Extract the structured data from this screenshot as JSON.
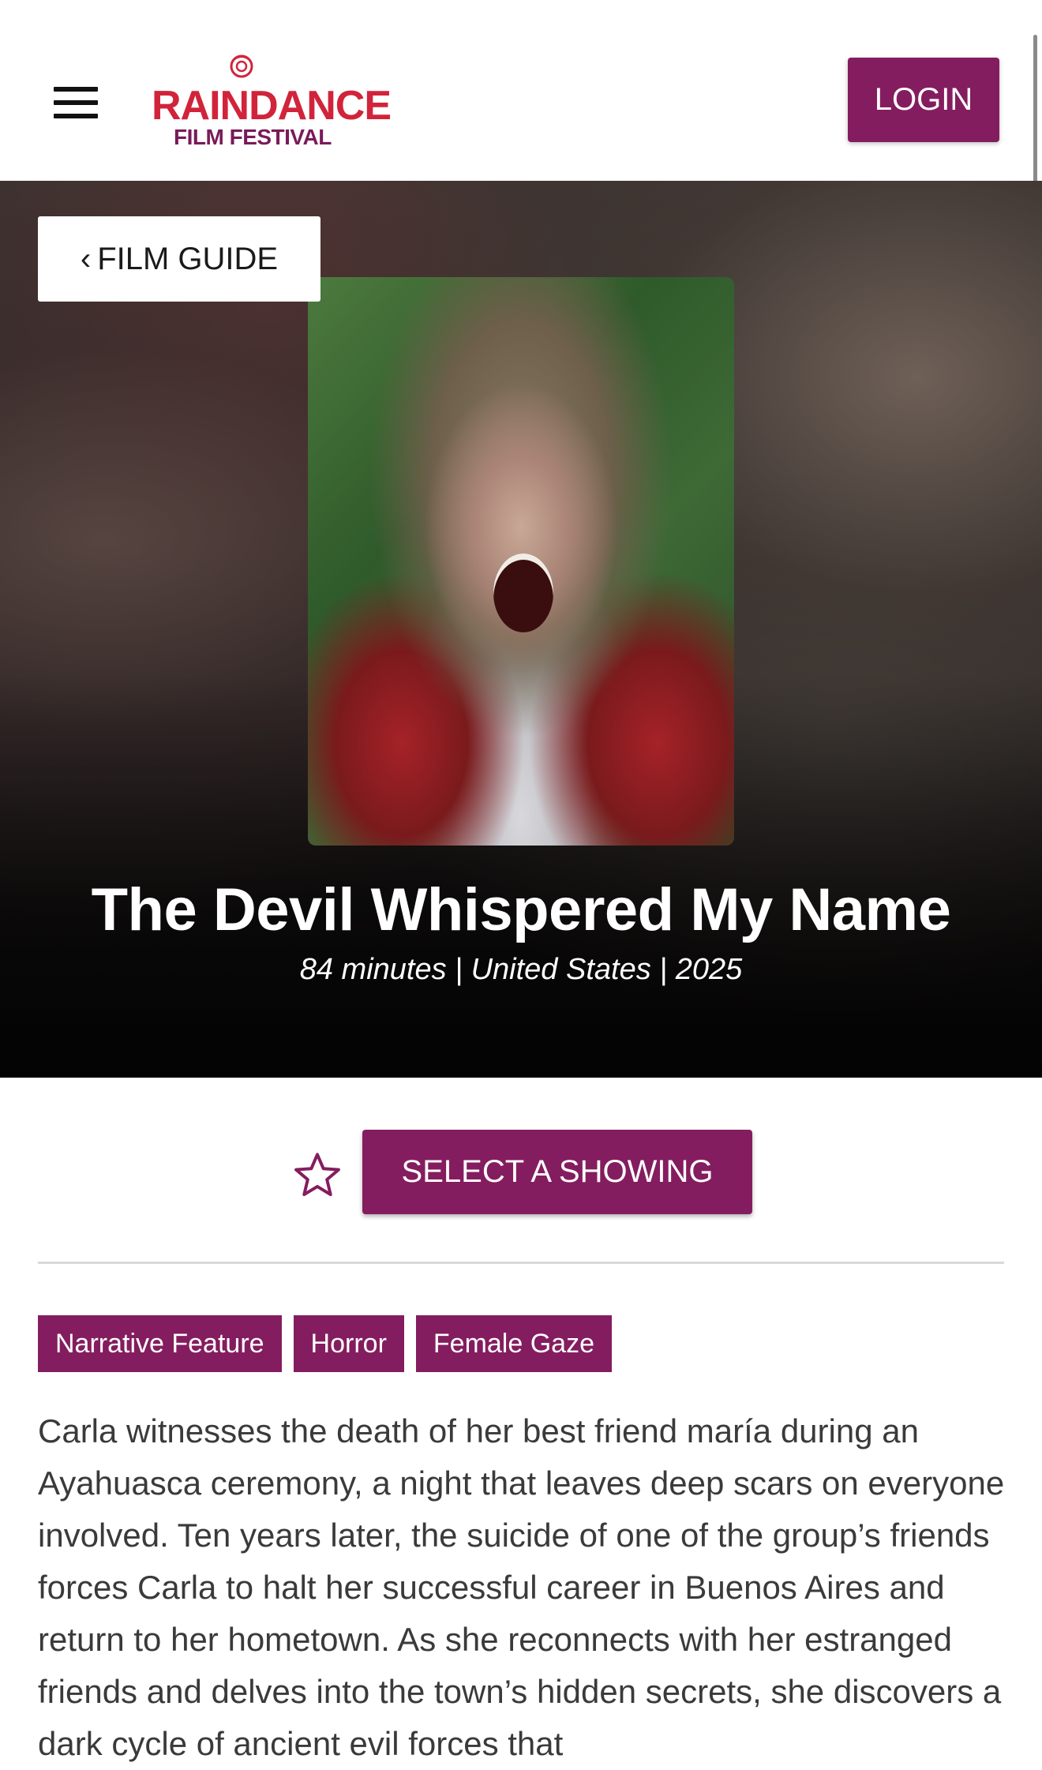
{
  "header": {
    "logo": {
      "line1": "RAINDANCE",
      "line2": "FILM FESTIVAL"
    },
    "menu_icon": "hamburger-icon",
    "login_label": "LOGIN"
  },
  "hero": {
    "back_label": "FILM GUIDE",
    "back_icon": "chevron-left-icon",
    "title": "The Devil Whispered My Name",
    "meta": "84 minutes | United States | 2025"
  },
  "actions": {
    "favorite_icon": "star-outline-icon",
    "select_label": "SELECT A SHOWING"
  },
  "tags": [
    {
      "label": "Narrative Feature"
    },
    {
      "label": "Horror"
    },
    {
      "label": "Female Gaze"
    }
  ],
  "synopsis": "Carla witnesses the death of her best friend maría during an Ayahuasca ceremony, a night that leaves deep scars on everyone involved. Ten years later, the suicide of one of the group’s friends forces Carla to halt her successful career in Buenos Aires and return to her hometown. As she reconnects with her estranged friends and delves into the town’s hidden secrets, she discovers a dark cycle of ancient evil forces that",
  "colors": {
    "brand": "#841d5f",
    "logo_red": "#d1243b",
    "text": "#3a3a3a"
  }
}
